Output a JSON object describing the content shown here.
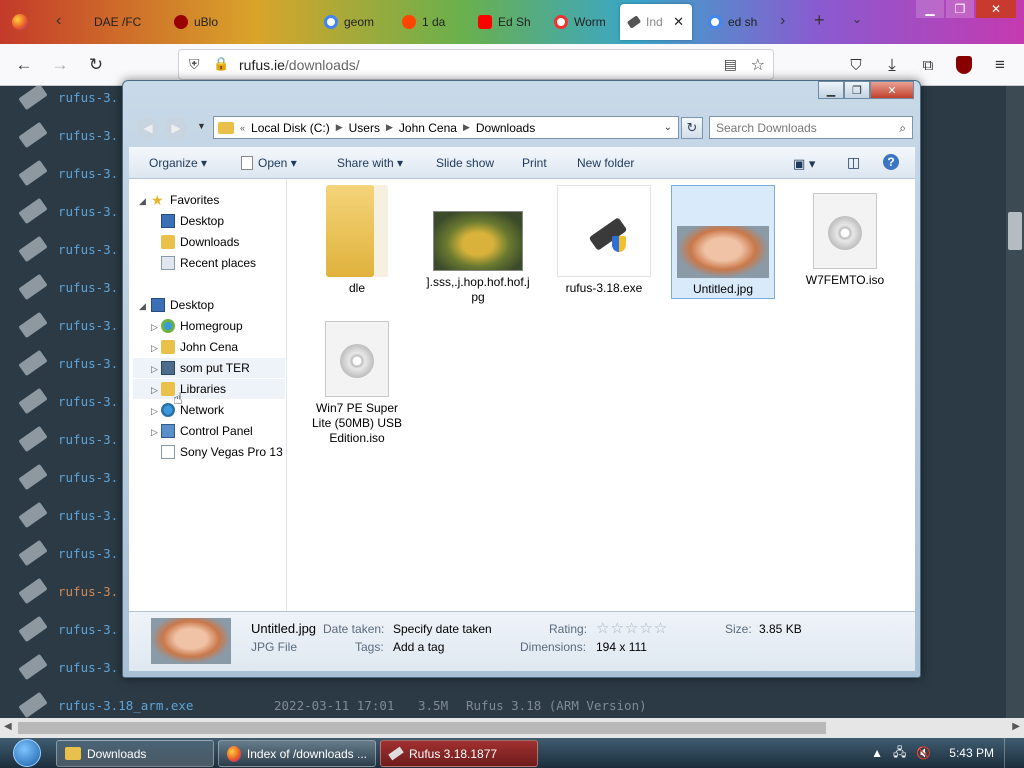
{
  "browser": {
    "tabs": [
      {
        "label": "DAE /FC",
        "color": "#e34"
      },
      {
        "label": "uBlo",
        "color": "#900"
      },
      {
        "label": "geom",
        "color": "#4285f4"
      },
      {
        "label": "1 da",
        "color": "#ff4500"
      },
      {
        "label": "Ed Sh",
        "color": "#f00"
      },
      {
        "label": "Worm",
        "color": "#e33"
      },
      {
        "label": "Ind",
        "color": "#555"
      },
      {
        "label": "ed sh",
        "color": "#4285f4"
      }
    ],
    "url_host": "rufus.ie",
    "url_path": "/downloads/"
  },
  "page": {
    "rows": [
      {
        "name": "rufus-3."
      },
      {
        "name": "rufus-3."
      },
      {
        "name": "rufus-3."
      },
      {
        "name": "rufus-3."
      },
      {
        "name": "rufus-3."
      },
      {
        "name": "rufus-3."
      },
      {
        "name": "rufus-3."
      },
      {
        "name": "rufus-3."
      },
      {
        "name": "rufus-3."
      },
      {
        "name": "rufus-3."
      },
      {
        "name": "rufus-3."
      },
      {
        "name": "rufus-3."
      },
      {
        "name": "rufus-3."
      },
      {
        "name": "rufus-3."
      },
      {
        "name": "rufus-3."
      },
      {
        "name": "rufus-3."
      }
    ],
    "last_row": {
      "name": "rufus-3.18_arm.exe",
      "date": "2022-03-11 17:01",
      "size": "3.5M",
      "desc": "Rufus 3.18 (ARM Version)"
    }
  },
  "explorer": {
    "breadcrumb": [
      "Local Disk (C:)",
      "Users",
      "John Cena",
      "Downloads"
    ],
    "search_placeholder": "Search Downloads",
    "toolbar": {
      "organize": "Organize",
      "open": "Open",
      "share": "Share with",
      "slideshow": "Slide show",
      "print": "Print",
      "new_folder": "New folder"
    },
    "nav": {
      "favorites": "Favorites",
      "desktop_fav": "Desktop",
      "downloads": "Downloads",
      "recent": "Recent places",
      "desktop": "Desktop",
      "homegroup": "Homegroup",
      "john": "John Cena",
      "computer": "som put TER",
      "libraries": "Libraries",
      "network": "Network",
      "control": "Control Panel",
      "sony": "Sony Vegas Pro 13"
    },
    "files": [
      {
        "name": "dle"
      },
      {
        "name": "].sss,.j.hop.hof.hof.jpg"
      },
      {
        "name": "rufus-3.18.exe"
      },
      {
        "name": "Untitled.jpg"
      },
      {
        "name": "W7FEMTO.iso"
      },
      {
        "name": "Win7 PE Super Lite (50MB) USB Edition.iso"
      }
    ],
    "details": {
      "name": "Untitled.jpg",
      "type": "JPG File",
      "date_taken_label": "Date taken:",
      "date_taken_value": "Specify date taken",
      "tags_label": "Tags:",
      "tags_value": "Add a tag",
      "rating_label": "Rating:",
      "dimensions_label": "Dimensions:",
      "dimensions_value": "194 x 111",
      "size_label": "Size:",
      "size_value": "3.85 KB"
    }
  },
  "taskbar": {
    "items": [
      "Downloads",
      "Index of /downloads ...",
      "Rufus 3.18.1877"
    ],
    "time": "5:43 PM"
  }
}
